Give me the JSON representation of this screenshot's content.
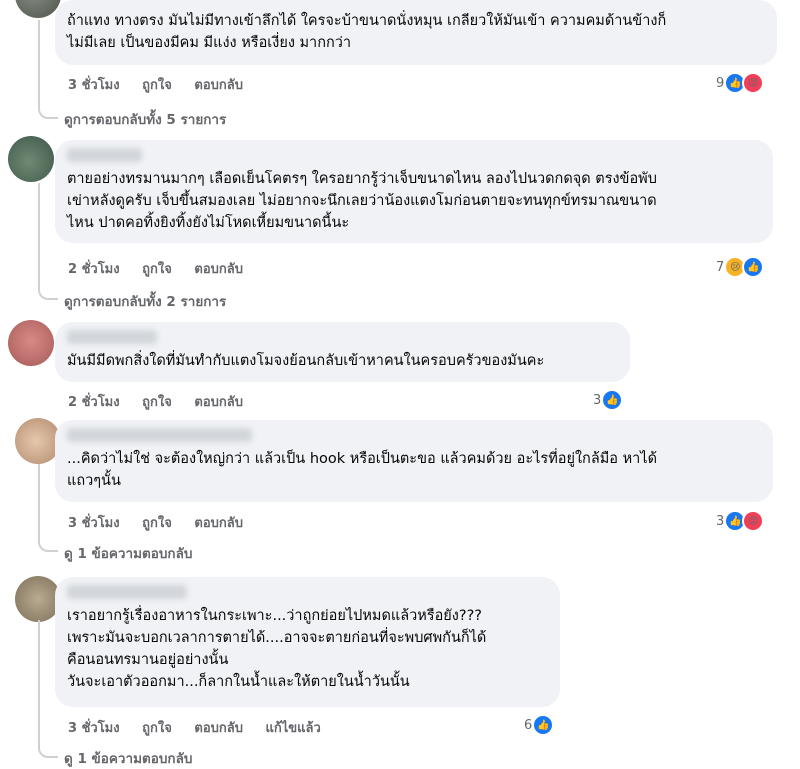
{
  "comments": [
    {
      "lines": [
        "ถ้าแทง ทางตรง มันไม่มีทางเข้าลึกได้ ใครจะบ้าขนาดนั่งหมุน เกลียวให้มันเข้า ความคมด้านข้างก็",
        "ไม่มีเลย เป็นของมีคม มีแง่ง หรือเงี่ยง มากกว่า"
      ],
      "time": "3 ชั่วโมง",
      "like": "ถูกใจ",
      "reply": "ตอบกลับ",
      "reaction_count": "9",
      "reactions": [
        "like-icon",
        "angry-icon"
      ],
      "more_replies": "ดูการตอบกลับทั้ง 5 รายการ"
    },
    {
      "lines": [
        "ตายอย่างทรมานมากๆ เลือดเย็นโคตรๆ ใครอยากรู้ว่าเจ็บขนาดไหน ลองไปนวดกดจุด ตรงข้อพับ",
        "เข่าหลังดูครับ เจ็บขึ้นสมองเลย ไม่อยากจะนึกเลยว่าน้องแตงโมก่อนตายจะทนทุกข์ทรมาณขนาด",
        "ไหน ปาดคอทิ้งยิงทิ้งยังไม่โหดเหี้ยมขนาดนี้นะ"
      ],
      "time": "2 ชั่วโมง",
      "like": "ถูกใจ",
      "reply": "ตอบกลับ",
      "reaction_count": "7",
      "reactions": [
        "sad-icon",
        "like-icon"
      ],
      "more_replies": "ดูการตอบกลับทั้ง 2 รายการ"
    },
    {
      "lines": [
        "มันมีมีดพกสิ่งใดที่มันทำกับแตงโมจงย้อนกลับเข้าหาคนในครอบครัวของมันคะ"
      ],
      "time": "2 ชั่วโมง",
      "like": "ถูกใจ",
      "reply": "ตอบกลับ",
      "reaction_count": "3",
      "reactions": [
        "like-icon"
      ]
    },
    {
      "lines": [
        "...คิดว่าไม่ใช่ จะต้องใหญ่กว่า แล้วเป็น hook หรือเป็นตะขอ แล้วคมด้วย อะไรที่อยู่ใกล้มือ หาได้",
        "แถวๆนั้น"
      ],
      "time": "3 ชั่วโมง",
      "like": "ถูกใจ",
      "reply": "ตอบกลับ",
      "reaction_count": "3",
      "reactions": [
        "like-icon",
        "angry-icon"
      ],
      "more_replies": "ดู 1 ข้อความตอบกลับ"
    },
    {
      "lines": [
        "เราอยากรู้เรื่องอาหารในกระเพาะ...ว่าถูกย่อยไปหมดแล้วหรือยัง???",
        "เพราะมันจะบอกเวลาการตายได้....อาจจะตายก่อนที่จะพบศพกันก็ได้",
        "คือนอนทรมานอยู่อย่างนั้น",
        "วันจะเอาตัวออกมา...ก็ลากในน้ำและให้ตายในน้ำวันนั้น"
      ],
      "time": "3 ชั่วโมง",
      "like": "ถูกใจ",
      "reply": "ตอบกลับ",
      "edited": "แก้ไขแล้ว",
      "reaction_count": "6",
      "reactions": [
        "like-icon"
      ],
      "more_replies": "ดู 1 ข้อความตอบกลับ"
    }
  ]
}
